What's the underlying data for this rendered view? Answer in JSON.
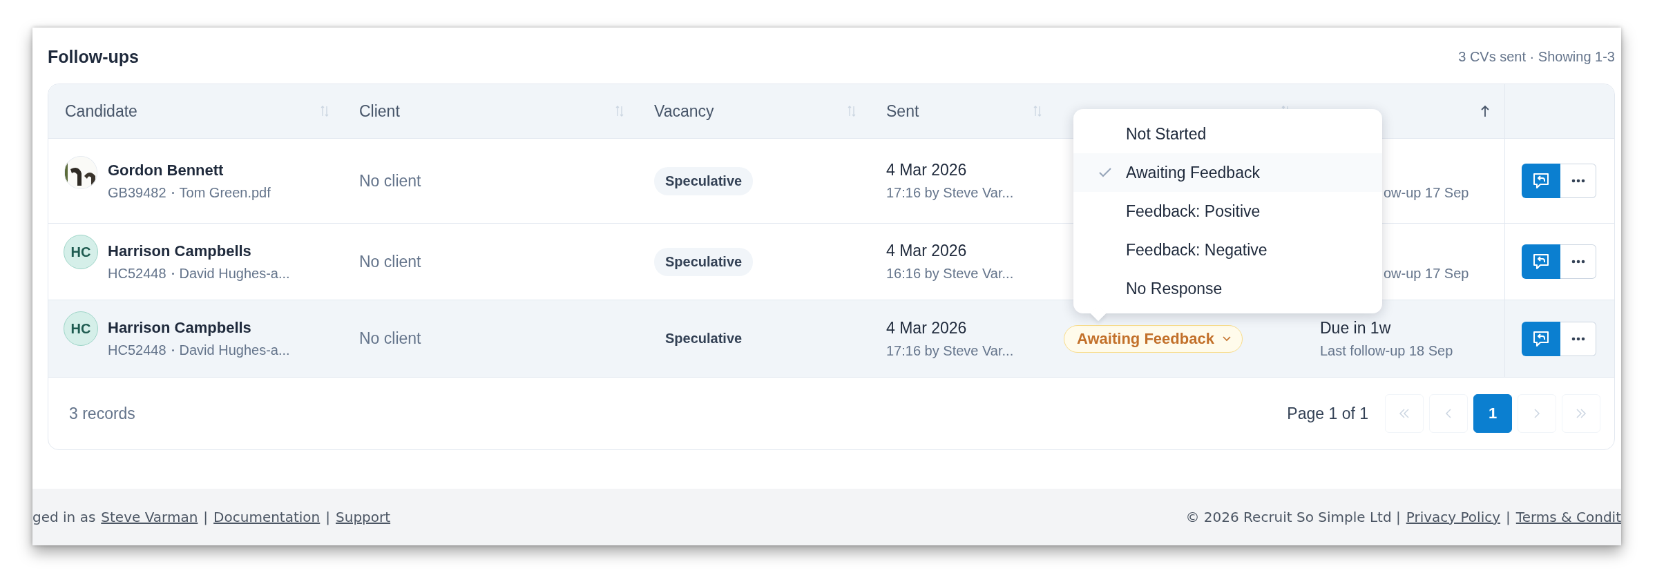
{
  "section": {
    "title": "Follow-ups",
    "summary": "3 CVs sent · Showing 1-3"
  },
  "table": {
    "columns": [
      {
        "label": "Candidate",
        "sorted_ascending": false
      },
      {
        "label": "Client",
        "sorted_ascending": false
      },
      {
        "label": "Vacancy",
        "sorted_ascending": false
      },
      {
        "label": "Sent",
        "sorted_ascending": false
      },
      {
        "sorted_ascending": false
      },
      {
        "sorted_ascending": true
      }
    ],
    "rows": [
      {
        "highlighted": false,
        "name": "Gordon Bennett",
        "ref": "GB39482",
        "file": "Tom Green.pdf",
        "client": "No client",
        "vacancy": "Speculative",
        "sent_date": "4 Mar 2026",
        "sent_by": "17:16 by Steve Var...",
        "due": {
          "note": "ow-up 17 Sep"
        }
      },
      {
        "highlighted": false,
        "avatar": {
          "kind": "initials",
          "text": "HC"
        },
        "name": "Harrison Campbells",
        "ref": "HC52448",
        "file": "David Hughes-a...",
        "client": "No client",
        "vacancy": "Speculative",
        "sent_date": "4 Mar 2026",
        "sent_by": "16:16 by Steve Var...",
        "due": {
          "note": "ow-up 17 Sep"
        }
      },
      {
        "highlighted": true,
        "avatar": {
          "kind": "initials",
          "text": "HC"
        },
        "name": "Harrison Campbells",
        "ref": "HC52448",
        "file": "David Hughes-a...",
        "client": "No client",
        "vacancy": "Speculative",
        "sent_date": "4 Mar 2026",
        "sent_by": "17:16 by Steve Var...",
        "status": {
          "label": "Awaiting Feedback",
          "open": true
        },
        "due": {
          "text": "Due in 1w",
          "note": "Last follow-up 18 Sep"
        }
      }
    ],
    "records": "3 records",
    "pagination": {
      "label": "Page 1 of 1",
      "pages": [
        {
          "label": "1",
          "selected": true
        }
      ]
    }
  },
  "status_menu": {
    "options": [
      {
        "label": "Not Started",
        "selected": false
      },
      {
        "label": "Awaiting Feedback",
        "selected": true
      },
      {
        "label": "Feedback: Positive",
        "selected": false
      },
      {
        "label": "Feedback: Negative",
        "selected": false
      },
      {
        "label": "No Response",
        "selected": false
      }
    ]
  },
  "footer": {
    "left": [
      {
        "kind": "text",
        "text": "ged in as"
      },
      {
        "kind": "link",
        "text": "Steve Varman"
      },
      {
        "kind": "text",
        "text": "|"
      },
      {
        "kind": "link",
        "text": "Documentation"
      },
      {
        "kind": "text",
        "text": "|"
      },
      {
        "kind": "link",
        "text": "Support"
      }
    ],
    "right": [
      {
        "kind": "text",
        "text": "© 2026 Recruit So Simple Ltd |"
      },
      {
        "kind": "link",
        "text": "Privacy Policy"
      },
      {
        "kind": "text",
        "text": "|"
      },
      {
        "kind": "link",
        "text": "Terms & Condit"
      }
    ]
  }
}
